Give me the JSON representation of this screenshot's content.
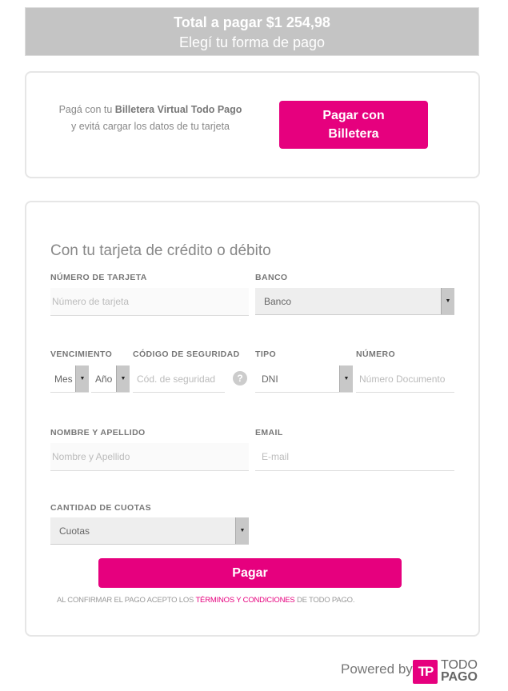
{
  "header": {
    "total": "Total a pagar $1 254,98",
    "subtitle": "Elegí tu forma de pago"
  },
  "wallet": {
    "line1_pre": "Pagá con tu ",
    "line1_bold": "Billetera Virtual Todo Pago",
    "line2": "y evitá cargar los datos de tu tarjeta",
    "button": "Pagar con Billetera"
  },
  "form": {
    "title": "Con tu tarjeta de crédito o débito",
    "card_number": {
      "label": "NÚMERO DE TARJETA",
      "placeholder": "Número de tarjeta"
    },
    "bank": {
      "label": "BANCO",
      "value": "Banco"
    },
    "expiry": {
      "label": "VENCIMIENTO",
      "month": "Mes",
      "year": "Año"
    },
    "cvv": {
      "label": "CÓDIGO DE SEGURIDAD",
      "placeholder": "Cód. de seguridad",
      "help": "?"
    },
    "doc_type": {
      "label": "TIPO",
      "value": "DNI"
    },
    "doc_number": {
      "label": "NÚMERO",
      "placeholder": "Número Documento"
    },
    "name": {
      "label": "NOMBRE Y APELLIDO",
      "placeholder": "Nombre y Apellido"
    },
    "email": {
      "label": "EMAIL",
      "placeholder": "E-mail"
    },
    "installments": {
      "label": "CANTIDAD DE CUOTAS",
      "value": "Cuotas"
    },
    "pay_button": "Pagar",
    "terms_pre": "AL CONFIRMAR EL PAGO ACEPTO LOS ",
    "terms_link": "TÉRMINOS Y CONDICIONES",
    "terms_post": " DE TODO PAGO."
  },
  "footer": {
    "powered": "Powered by",
    "logo_mark": "TP",
    "logo_text1": "TODO",
    "logo_text2": "PAGO"
  },
  "colors": {
    "accent": "#e6007e",
    "header_bg": "#c4c4c4"
  }
}
